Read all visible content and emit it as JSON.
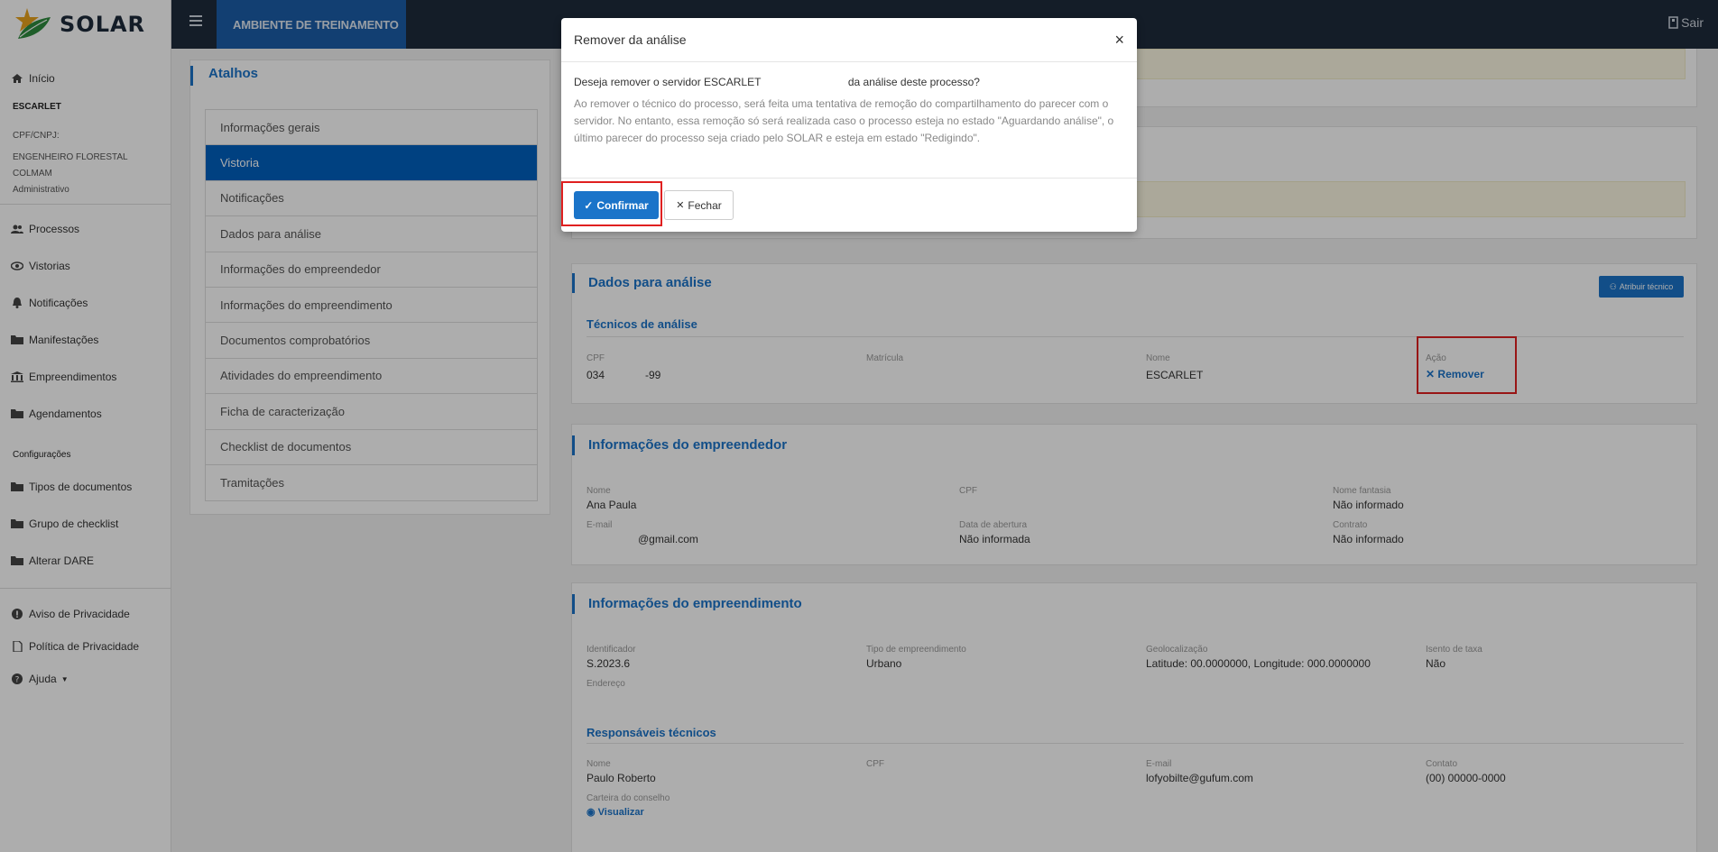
{
  "app": {
    "logo_text": "SOLAR",
    "environment": "AMBIENTE DE TREINAMENTO",
    "logout_label": "Sair"
  },
  "sidebar": {
    "home": "Início",
    "user": {
      "name": "ESCARLET",
      "doc": "CPF/CNPJ:",
      "role": "ENGENHEIRO FLORESTAL",
      "org": "COLMAM",
      "profile": "Administrativo"
    },
    "items": [
      "Processos",
      "Vistorias",
      "Notificações",
      "Manifestações",
      "Empreendimentos",
      "Agendamentos"
    ],
    "config_title": "Configurações",
    "config_items": [
      "Tipos de documentos",
      "Grupo de checklist",
      "Alterar DARE"
    ],
    "footer_items": [
      "Aviso de Privacidade",
      "Política de Privacidade",
      "Ajuda"
    ]
  },
  "atalhos": {
    "title": "Atalhos",
    "items": [
      "Informações gerais",
      "Vistoria",
      "Notificações",
      "Dados para análise",
      "Informações do empreendedor",
      "Informações do empreendimento",
      "Documentos comprobatórios",
      "Atividades do empreendimento",
      "Ficha de caracterização",
      "Checklist de documentos",
      "Tramitações"
    ]
  },
  "dados_analise": {
    "title": "Dados para análise",
    "assign_button": "Atribuir técnico",
    "subtitle": "Técnicos de análise",
    "labels": {
      "cpf": "CPF",
      "matricula": "Matrícula",
      "nome": "Nome",
      "acao": "Ação"
    },
    "values": {
      "cpf_start": "034",
      "cpf_end": "-99",
      "nome": "ESCARLET",
      "acao": "Remover"
    }
  },
  "empreendedor": {
    "title": "Informações do empreendedor",
    "labels": {
      "nome": "Nome",
      "cpf": "CPF",
      "fantasia": "Nome fantasia",
      "email": "E-mail",
      "abertura": "Data de abertura",
      "contrato": "Contrato"
    },
    "values": {
      "nome": "Ana Paula",
      "fantasia": "Não informado",
      "email": "@gmail.com",
      "abertura": "Não informada",
      "contrato": "Não informado"
    }
  },
  "empreendimento": {
    "title": "Informações do empreendimento",
    "labels": {
      "id": "Identificador",
      "tipo": "Tipo de empreendimento",
      "geo": "Geolocalização",
      "isento": "Isento de taxa",
      "endereco": "Endereço"
    },
    "values": {
      "id": "S.2023.6",
      "tipo": "Urbano",
      "geo": "Latitude: 00.0000000, Longitude: 000.0000000",
      "isento": "Não"
    },
    "resp_title": "Responsáveis técnicos",
    "resp_labels": {
      "nome": "Nome",
      "cpf": "CPF",
      "email": "E-mail",
      "contato": "Contato",
      "carteira": "Carteira do conselho"
    },
    "resp_values": {
      "nome": "Paulo Roberto",
      "email": "lofyobilte@gufum.com",
      "contato": "(00) 00000-0000",
      "carteira": "Visualizar"
    }
  },
  "modal": {
    "title": "Remover da análise",
    "close": "×",
    "question_start": "Deseja remover o servidor ESCARLET",
    "question_end": "da análise deste processo?",
    "message": "Ao remover o técnico do processo, será feita uma tentativa de remoção do compartilhamento do parecer com o servidor. No entanto, essa remoção só será realizada caso o processo esteja no estado \"Aguardando análise\", o último parecer do processo seja criado pelo SOLAR e esteja em estado \"Redigindo\".",
    "confirm": "Confirmar",
    "cancel": "Fechar"
  },
  "colors": {
    "accent": "#1b74c9",
    "topbar": "#1e2b3b",
    "highlight": "#e02020"
  }
}
